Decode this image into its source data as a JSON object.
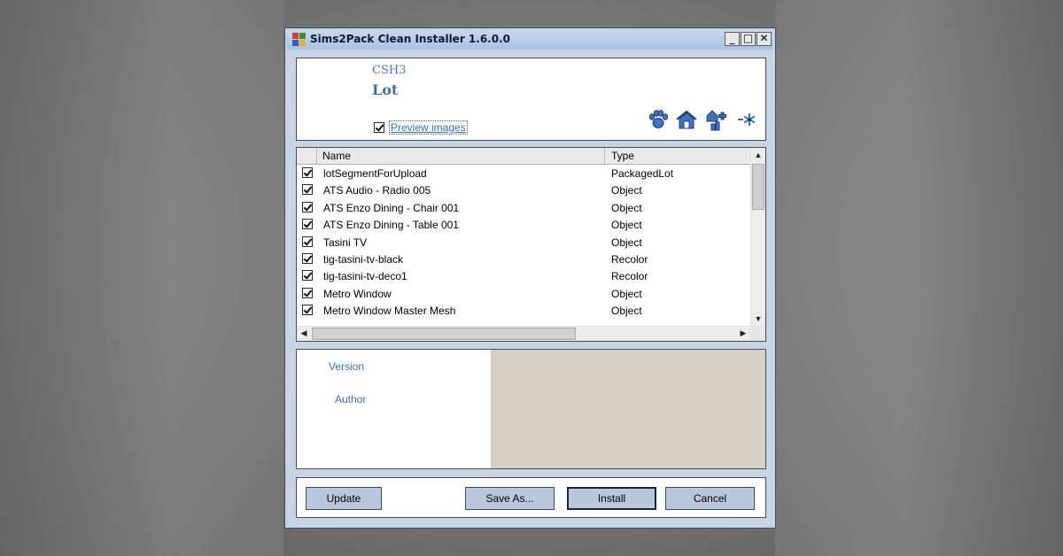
{
  "window": {
    "title": "Sims2Pack Clean Installer 1.6.0.0",
    "controls": {
      "minimize": "_",
      "maximize": "□",
      "close": "✕"
    }
  },
  "package": {
    "code": "CSH3",
    "type": "Lot",
    "preview_images_label": "Preview images",
    "preview_images_checked": true,
    "toolbar_icons": [
      "pawprint-icon",
      "house-icon",
      "neighborhood-icon",
      "snowflake-icon"
    ]
  },
  "list": {
    "columns": {
      "name": "Name",
      "type": "Type"
    },
    "rows": [
      {
        "name": "lotSegmentForUpload",
        "type": "PackagedLot",
        "checked": true
      },
      {
        "name": "ATS Audio - Radio 005",
        "type": "Object",
        "checked": true
      },
      {
        "name": "ATS Enzo Dining - Chair 001",
        "type": "Object",
        "checked": true
      },
      {
        "name": "ATS Enzo Dining - Table 001",
        "type": "Object",
        "checked": true
      },
      {
        "name": "Tasini TV",
        "type": "Object",
        "checked": true
      },
      {
        "name": "tig-tasini-tv-black",
        "type": "Recolor",
        "checked": true
      },
      {
        "name": "tig-tasini-tv-deco1",
        "type": "Recolor",
        "checked": true
      },
      {
        "name": "Metro Window",
        "type": "Object",
        "checked": true
      },
      {
        "name": "Metro Window Master Mesh",
        "type": "Object",
        "checked": true
      }
    ]
  },
  "info": {
    "version_label": "Version",
    "author_label": "Author"
  },
  "buttons": {
    "update": "Update",
    "save_as": "Save As...",
    "install": "Install",
    "cancel": "Cancel"
  },
  "colors": {
    "accent_blue": "#3f6fb0",
    "button_fill": "#b9c7dc",
    "window_frame": "#c7d4e6"
  }
}
